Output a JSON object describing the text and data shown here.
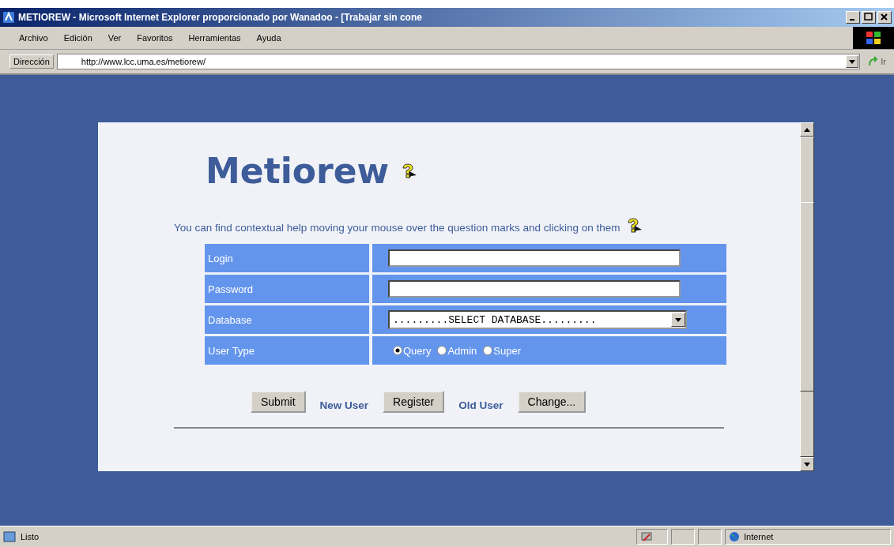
{
  "window": {
    "title": "METIOREW - Microsoft Internet Explorer proporcionado por Wanadoo - [Trabajar sin cone"
  },
  "menu": [
    "Archivo",
    "Edición",
    "Ver",
    "Favoritos",
    "Herramientas",
    "Ayuda"
  ],
  "address_bar": {
    "label": "Dirección",
    "url": "http://www.lcc.uma.es/metiorew/",
    "go": "Ir"
  },
  "page": {
    "heading": "Metiorew",
    "help_text": "You can find contextual help moving your mouse over the question marks and clicking on them",
    "form": [
      {
        "kind": "text",
        "label": "Login"
      },
      {
        "kind": "text",
        "label": "Password"
      },
      {
        "kind": "select",
        "label": "Database",
        "value": ".........SELECT DATABASE........."
      },
      {
        "kind": "radio",
        "label": "User Type",
        "options": [
          {
            "label": "Query",
            "selected": true
          },
          {
            "label": "Admin",
            "selected": false
          },
          {
            "label": "Super",
            "selected": false
          }
        ]
      }
    ],
    "actions": [
      {
        "kind": "button",
        "label": "Submit"
      },
      {
        "kind": "link",
        "label": "New User"
      },
      {
        "kind": "button",
        "label": "Register"
      },
      {
        "kind": "link",
        "label": "Old User"
      },
      {
        "kind": "button",
        "label": "Change..."
      }
    ]
  },
  "status_bar": {
    "text": "Listo",
    "zone": "Internet"
  }
}
